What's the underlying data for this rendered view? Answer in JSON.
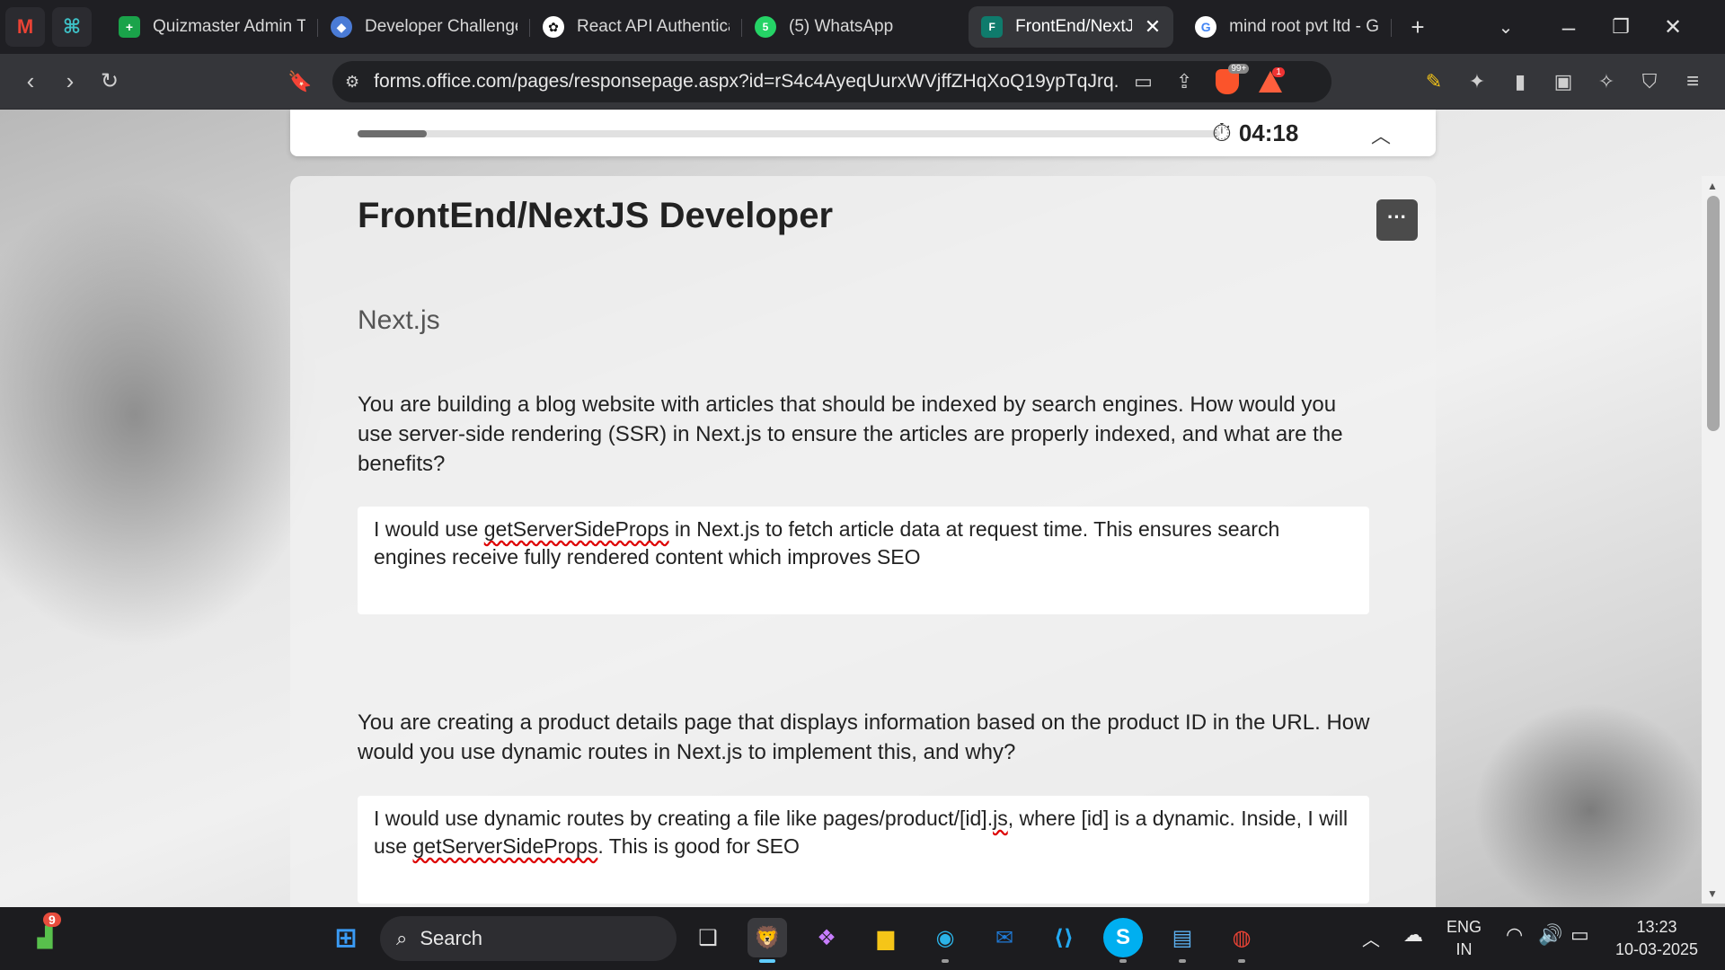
{
  "tabs": [
    {
      "label": "Quizmaster Admin Ta",
      "icon": "plus-green-icon",
      "color": "#1aa34a"
    },
    {
      "label": "Developer Challenge",
      "icon": "shield-icon",
      "color": "#4a7bd6"
    },
    {
      "label": "React API Authentica",
      "icon": "openai-icon",
      "color": "#ffffff"
    },
    {
      "label": "(5) WhatsApp",
      "icon": "whatsapp-icon",
      "color": "#25d366"
    },
    {
      "label": "FrontEnd/NextJS",
      "icon": "forms-icon",
      "color": "#0f7b6c"
    },
    {
      "label": "mind root pvt ltd - G",
      "icon": "google-icon",
      "color": "#ffffff"
    }
  ],
  "url": "forms.office.com/pages/responsepage.aspx?id=rS4c4AyeqUurxWVjffZHqXoQ19ypTqJrq...",
  "badges": {
    "brave_shield": "99+",
    "rewards": "1"
  },
  "timer": {
    "time": "04:18",
    "progress": 0.08
  },
  "form": {
    "title": "FrontEnd/NextJS Developer",
    "section": "Next.js",
    "q1": "You are building a blog website with articles that should be indexed by search engines. How would you use server-side rendering (SSR) in Next.js to ensure the articles are properly indexed, and what are the benefits?",
    "a1_pre": "I would use ",
    "a1_code": "getServerSideProps",
    "a1_post": " in Next.js to fetch article data at request time. This ensures search engines receive fully rendered content which improves SEO",
    "q2": "You are creating a product details page that displays information based on the product ID in the URL. How would you use dynamic routes in Next.js to implement this, and why?",
    "a2_pre": "I would use dynamic routes by creating a file like pages/product/[id].",
    "a2_js": "js",
    "a2_mid": ", where [id] is a dynamic. Inside, I will use ",
    "a2_code": "getServerSideProps",
    "a2_post": ". This is good for SEO"
  },
  "taskbar": {
    "search_placeholder": "Search",
    "weather_badge": "9",
    "lang": "ENG",
    "region": "IN",
    "time": "13:23",
    "date": "10-03-2025"
  }
}
